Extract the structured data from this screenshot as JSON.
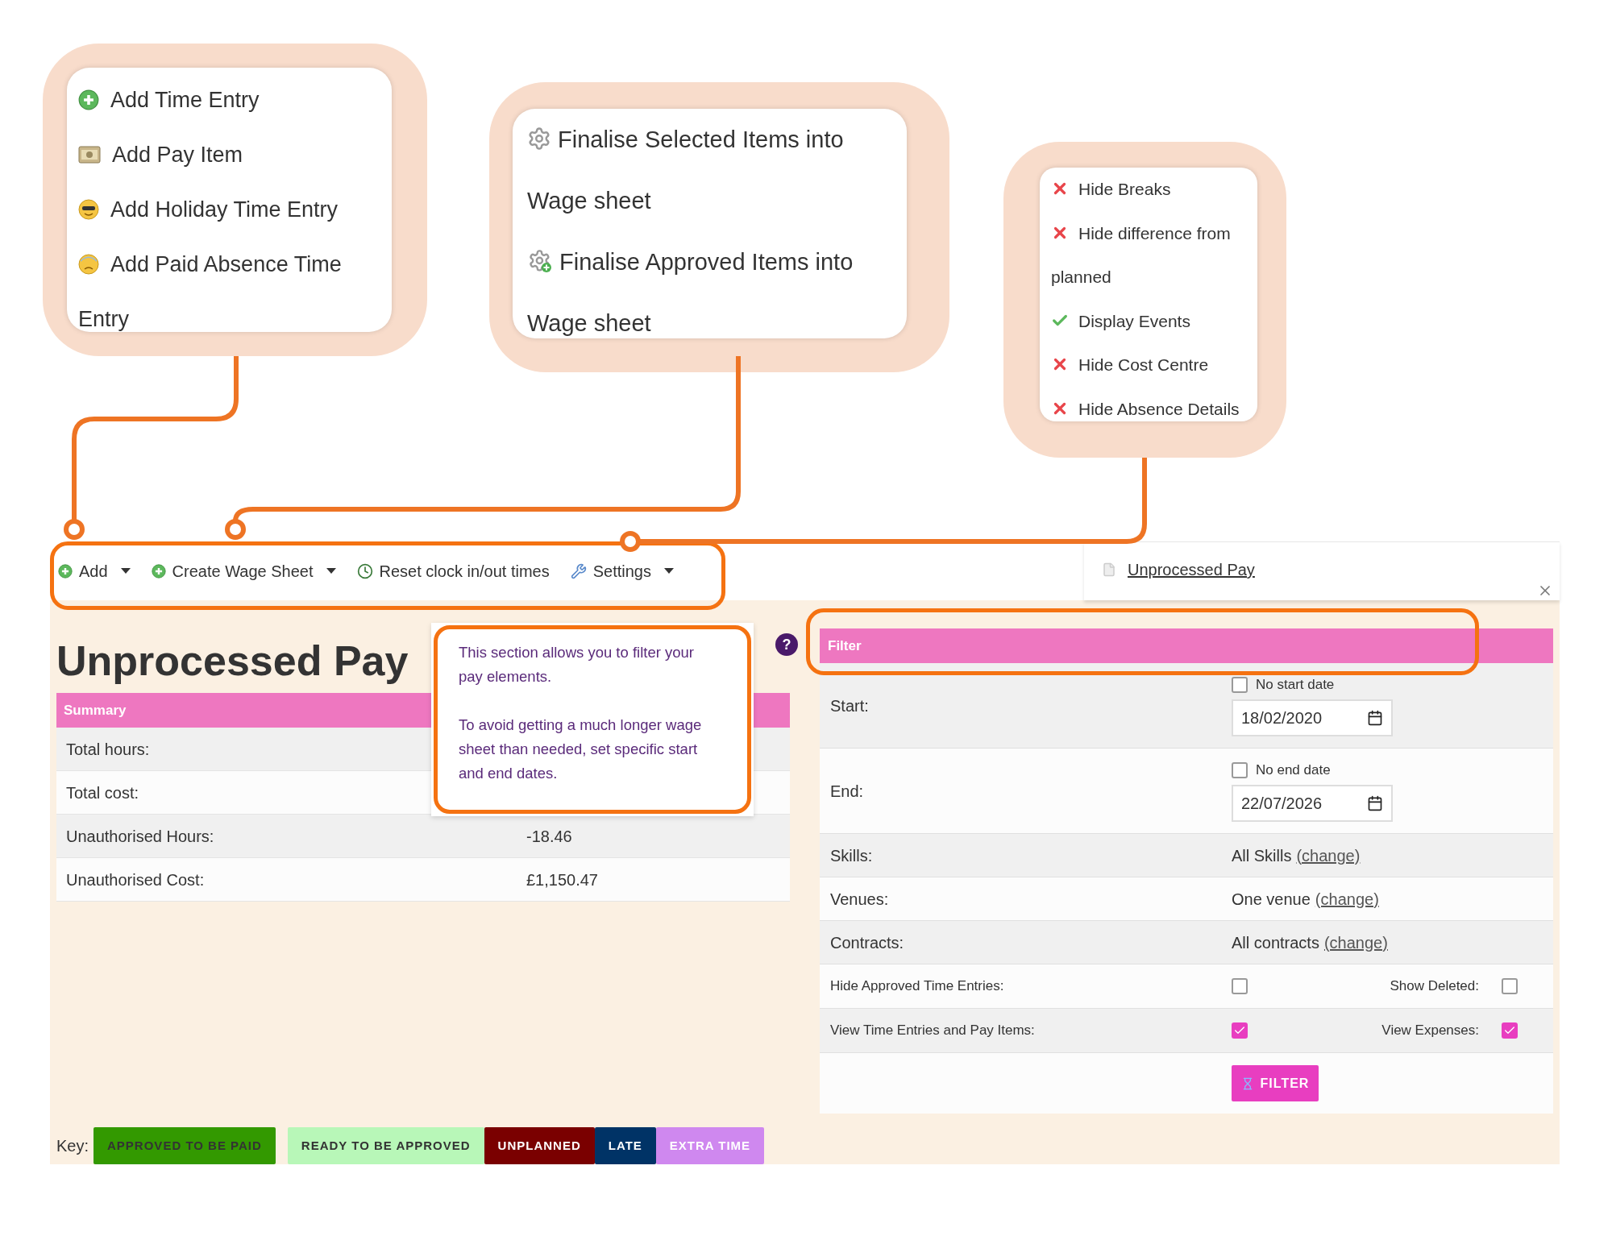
{
  "callouts": {
    "add_menu": [
      {
        "label": "Add Time Entry",
        "kind": "plus"
      },
      {
        "label": "Add Pay Item",
        "kind": "cash"
      },
      {
        "label": "Add Holiday Time Entry",
        "kind": "holiday"
      },
      {
        "label": "Add Paid Absence Time Entry",
        "kind": "absence"
      }
    ],
    "wage_sheet_menu": [
      {
        "label": "Finalise Selected Items into Wage sheet",
        "kind": "gear"
      },
      {
        "label": "Finalise Approved Items into Wage sheet",
        "kind": "gear_plus"
      }
    ],
    "settings_menu": [
      {
        "label": "Hide Breaks",
        "checked": false
      },
      {
        "label": "Hide difference from planned",
        "checked": false
      },
      {
        "label": "Display Events",
        "checked": true
      },
      {
        "label": "Hide Cost Centre",
        "checked": false
      },
      {
        "label": "Hide Absence Details",
        "checked": false
      }
    ]
  },
  "toolbar": [
    {
      "label": "Add",
      "kind": "plus",
      "dropdown": true
    },
    {
      "label": "Create Wage Sheet",
      "kind": "plus",
      "dropdown": true
    },
    {
      "label": "Reset clock in/out times",
      "kind": "clock",
      "dropdown": false
    },
    {
      "label": "Settings",
      "kind": "wrench",
      "dropdown": true
    }
  ],
  "tab": {
    "label": "Unprocessed Pay"
  },
  "title": "Unprocessed Pay",
  "summary": {
    "header": "Summary",
    "rows": [
      {
        "label": "Total hours:"
      },
      {
        "label": "Total cost:"
      },
      {
        "label": "Unauthorised Hours:",
        "value": "-18.46"
      },
      {
        "label": "Unauthorised Cost:",
        "value": "£1,150.47"
      }
    ]
  },
  "tooltip": [
    "This section allows you to filter your pay elements.",
    "To avoid getting a much longer wage sheet than needed, set specific start and end dates."
  ],
  "help": "?",
  "filter": {
    "header": "Filter",
    "rows": [
      {
        "kind": "date",
        "label": "Start:",
        "option": "No start date",
        "checked": false,
        "value": "18/02/2020"
      },
      {
        "kind": "date",
        "label": "End:",
        "option": "No end date",
        "checked": false,
        "value": "22/07/2026"
      },
      {
        "kind": "link",
        "label": "Skills:",
        "value": "All Skills",
        "link": "(change)"
      },
      {
        "kind": "link",
        "label": "Venues:",
        "value": "One venue",
        "link": "(change)"
      },
      {
        "kind": "link",
        "label": "Contracts:",
        "value": "All contracts",
        "link": "(change)"
      },
      {
        "kind": "checks",
        "label": "Hide Approved Time Entries:",
        "checked": false,
        "label2": "Show Deleted:",
        "checked2": false
      },
      {
        "kind": "checks",
        "label": "View Time Entries and Pay Items:",
        "checked": true,
        "label2": "View Expenses:",
        "checked2": true
      }
    ],
    "button": "FILTER"
  },
  "key": {
    "label": "Key:",
    "items": [
      {
        "label": "APPROVED TO BE PAID",
        "color": "#339900",
        "kind": "dark"
      },
      {
        "label": "READY TO BE APPROVED",
        "color": "#b8f7b8",
        "kind": "dark"
      },
      {
        "label": "UNPLANNED",
        "color": "#7a0000",
        "kind": "light"
      },
      {
        "label": "LATE",
        "color": "#003366",
        "kind": "light"
      },
      {
        "label": "EXTRA TIME",
        "color": "#cf88ef",
        "kind": "light"
      }
    ]
  }
}
